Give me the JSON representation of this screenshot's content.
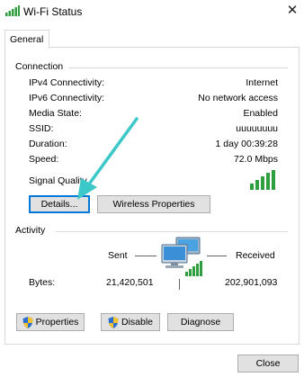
{
  "window": {
    "title": "Wi-Fi Status",
    "close_glyph": "✕"
  },
  "tabs": [
    {
      "label": "General",
      "selected": true
    }
  ],
  "connection": {
    "section_label": "Connection",
    "rows": [
      {
        "label": "IPv4 Connectivity:",
        "value": "Internet"
      },
      {
        "label": "IPv6 Connectivity:",
        "value": "No network access"
      },
      {
        "label": "Media State:",
        "value": "Enabled"
      },
      {
        "label": "SSID:",
        "value": "uuuuuuuu"
      },
      {
        "label": "Duration:",
        "value": "1 day 00:39:28"
      },
      {
        "label": "Speed:",
        "value": "72.0 Mbps"
      }
    ],
    "signal_label": "Signal Quality",
    "details_button": "Details...",
    "wireless_button": "Wireless Properties"
  },
  "activity": {
    "section_label": "Activity",
    "sent_label": "Sent",
    "received_label": "Received",
    "bytes_label": "Bytes:",
    "bytes_sent": "21,420,501",
    "bytes_received": "202,901,093",
    "properties_button": "Properties",
    "disable_button": "Disable",
    "diagnose_button": "Diagnose"
  },
  "footer": {
    "close_button": "Close"
  },
  "colors": {
    "signal_green": "#2e9e3e",
    "focus_blue": "#0078d7",
    "annotation_arrow": "#3cc7c9"
  },
  "icons": {
    "title_icon": "wifi-signal-icon",
    "signal_icon": "signal-bars-icon",
    "network_icon": "network-computers-icon",
    "shield_icon": "uac-shield-icon",
    "arrow": "annotation-arrow"
  }
}
